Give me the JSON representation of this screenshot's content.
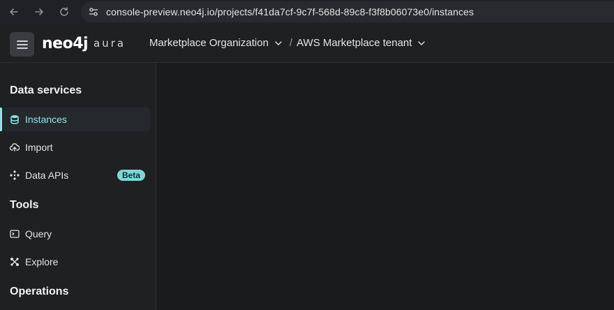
{
  "browser": {
    "url": "console-preview.neo4j.io/projects/f41da7cf-9c7f-568d-89c8-f3f8b06073e0/instances",
    "back_icon": "arrow-left-icon",
    "forward_icon": "arrow-right-icon",
    "reload_icon": "reload-icon",
    "site_settings_icon": "tune-icon"
  },
  "header": {
    "menu_icon": "hamburger-icon",
    "logo_main": "neo4j",
    "logo_sub": "aura",
    "breadcrumbs": [
      {
        "label": "Marketplace Organization",
        "has_dropdown": true
      },
      {
        "label": "AWS Marketplace tenant",
        "has_dropdown": true
      }
    ],
    "separator": "/"
  },
  "sidebar": {
    "sections": [
      {
        "title": "Data services",
        "items": [
          {
            "label": "Instances",
            "icon": "database-icon",
            "active": true
          },
          {
            "label": "Import",
            "icon": "cloud-upload-icon"
          },
          {
            "label": "Data APIs",
            "icon": "graph-nodes-icon",
            "badge": "Beta"
          }
        ]
      },
      {
        "title": "Tools",
        "items": [
          {
            "label": "Query",
            "icon": "terminal-icon"
          },
          {
            "label": "Explore",
            "icon": "explore-graph-icon"
          }
        ]
      },
      {
        "title": "Operations",
        "items": []
      }
    ]
  },
  "colors": {
    "accent": "#8fe3e8",
    "badge_bg": "#7ed6da",
    "background": "#1a1b1d",
    "panel": "#1f2022"
  }
}
